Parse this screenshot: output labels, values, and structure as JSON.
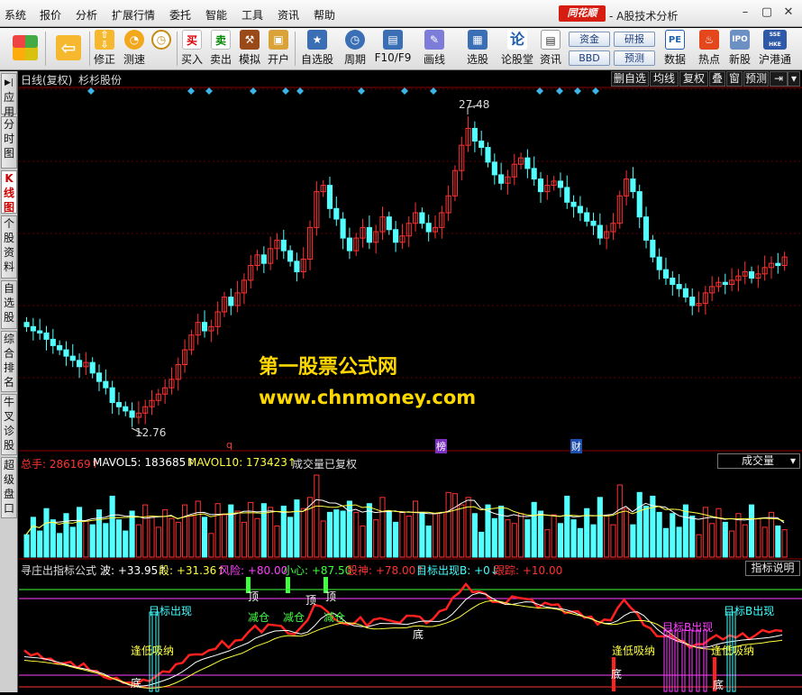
{
  "menu": [
    "系统",
    "报价",
    "分析",
    "扩展行情",
    "委托",
    "智能",
    "工具",
    "资讯",
    "帮助"
  ],
  "brand": {
    "logo": "同花顺",
    "subtitle": "- A股技术分析"
  },
  "window_buttons": [
    "–",
    "▢",
    "✕"
  ],
  "toolbar": [
    {
      "label": "",
      "icon": "grid-icon"
    },
    {
      "label": "",
      "icon": "back-arrow-icon"
    },
    {
      "label": "修正",
      "icon": "arrows-updown-icon"
    },
    {
      "label": "测速",
      "icon": "speed-icon"
    },
    {
      "label": "买入",
      "icon": "buy-icon",
      "glyph": "买"
    },
    {
      "label": "卖出",
      "icon": "sell-icon",
      "glyph": "卖"
    },
    {
      "label": "模拟",
      "icon": "hammer-icon"
    },
    {
      "label": "开户",
      "icon": "lock-icon"
    },
    {
      "label": "自选股",
      "icon": "star-icon"
    },
    {
      "label": "周期",
      "icon": "clock-icon"
    },
    {
      "label": "F10/F9",
      "icon": "document-icon"
    },
    {
      "label": "画线",
      "icon": "pen-icon"
    },
    {
      "label": "选股",
      "icon": "screen-icon"
    },
    {
      "label": "论股堂",
      "icon": "chat-icon",
      "glyph": "论"
    },
    {
      "label": "资讯",
      "icon": "news-icon"
    },
    {
      "label": "数据",
      "icon": "pe-icon",
      "glyph": "PE"
    },
    {
      "label": "热点",
      "icon": "fire-icon"
    },
    {
      "label": "新股",
      "icon": "ipo-icon",
      "glyph": "IPO"
    },
    {
      "label": "沪港通",
      "icon": "hk-icon",
      "glyph": "SSE HKE"
    }
  ],
  "pills": [
    "资金",
    "研报",
    "BBD",
    "预测"
  ],
  "sidetabs": [
    "应用",
    "分时图",
    "K线图",
    "个股资料",
    "自选股",
    "综合排名",
    "牛叉诊股",
    "超级盘口"
  ],
  "chart": {
    "period": "日线(复权)",
    "stock": "杉杉股份",
    "top_buttons": [
      "删自选",
      "均线",
      "复权",
      "叠",
      "窗",
      "预测"
    ],
    "high_label": "27.48",
    "low_label": "12.76",
    "watermark1": "第一股票公式网",
    "watermark2": "www.chnmoney.com",
    "event_q": "q",
    "event_bang": "榜",
    "event_cai": "财"
  },
  "volume": {
    "total_label": "总手: 286169↑",
    "ma5_label": "MAVOL5: 183685↑",
    "ma10_label": "MAVOL10: 173423↑",
    "note": "成交量已复权",
    "selector": "成交量"
  },
  "indicator": {
    "name": "寻庄出指标公式",
    "wave": "波: +33.95↑",
    "duan": "段: +31.36↑",
    "risk": "风险: +80.00",
    "careful": "小心: +87.50",
    "god": "股神: +78.00↑",
    "target": "目标出现B: +0↓",
    "track": "跟踪: +10.00",
    "help_button": "指标说明",
    "ann_target": "目标出现",
    "ann_target_b": "目标B出现",
    "ann_reduce": "减仓",
    "ann_low": "逢低吸纳",
    "ann_bottom": "底",
    "ann_top": "顶"
  },
  "colors": {
    "up": "#ff3232",
    "down": "#54ffff",
    "ma5": "#ffffff",
    "ma10": "#ffff40",
    "accent": "#d61d12"
  },
  "chart_data": {
    "type": "candlestick",
    "note_high": 27.48,
    "note_low": 12.76,
    "closes": [
      17.2,
      17.0,
      16.9,
      16.6,
      16.3,
      16.1,
      15.8,
      15.6,
      15.3,
      15.5,
      15.0,
      14.6,
      14.3,
      13.6,
      13.4,
      13.2,
      12.9,
      13.1,
      13.4,
      13.7,
      14.0,
      14.3,
      14.7,
      15.4,
      16.1,
      16.8,
      17.4,
      17.0,
      17.2,
      17.9,
      18.6,
      18.2,
      18.8,
      19.4,
      20.1,
      20.6,
      20.2,
      20.9,
      21.3,
      20.8,
      20.3,
      19.8,
      20.4,
      21.9,
      23.6,
      23.9,
      22.8,
      22.3,
      21.4,
      20.8,
      21.4,
      21.9,
      21.2,
      21.7,
      22.4,
      21.8,
      21.2,
      21.5,
      22.1,
      22.6,
      22.1,
      21.7,
      21.9,
      22.6,
      23.4,
      24.6,
      25.8,
      26.6,
      26.0,
      25.7,
      25.0,
      24.4,
      24.0,
      24.3,
      24.9,
      25.2,
      24.7,
      24.2,
      23.6,
      23.9,
      24.1,
      23.8,
      23.1,
      22.9,
      22.6,
      22.2,
      22.0,
      21.4,
      21.7,
      22.1,
      23.4,
      24.2,
      23.6,
      22.4,
      21.3,
      20.5,
      19.9,
      19.5,
      19.2,
      19.0,
      18.6,
      18.2,
      18.3,
      18.8,
      19.1,
      19.3,
      19.2,
      19.4,
      19.6,
      19.8,
      19.5,
      19.7,
      20.0,
      20.2,
      20.1,
      20.5
    ]
  }
}
